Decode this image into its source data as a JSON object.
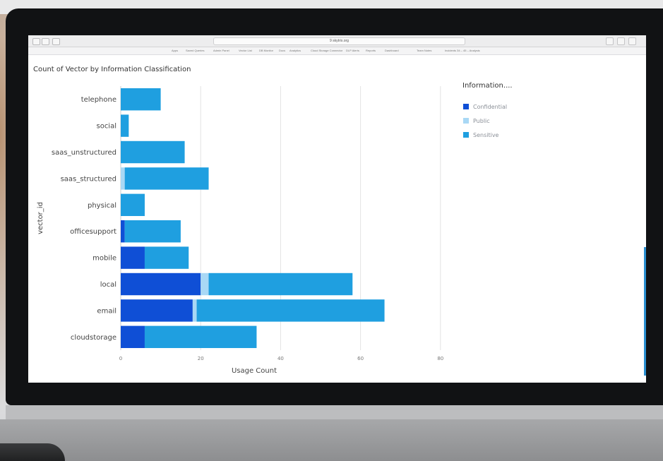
{
  "browser": {
    "address": "9 skytrix.org",
    "bookmarks": [
      "Apps",
      "Saved Queries",
      "Admin Panel",
      "Vector List",
      "DB Monitor",
      "Docs",
      "Analytics",
      "Cloud Storage Connector",
      "DLP Alerts",
      "Reports",
      "Dashboard",
      "Team Notes",
      "Incidents 34 – 45 – Analysis"
    ]
  },
  "chart_data": {
    "type": "bar",
    "orientation": "horizontal",
    "stacked": true,
    "title": "Count of Vector by Information Classification",
    "xlabel": "Usage Count",
    "ylabel": "vector_id",
    "categories": [
      "telephone",
      "social",
      "saas_unstructured",
      "saas_structured",
      "physical",
      "officesupport",
      "mobile",
      "local",
      "email",
      "cloudstorage"
    ],
    "series": [
      {
        "name": "Confidential",
        "color": "#0f4fd6",
        "values": [
          0,
          0,
          0,
          0,
          0,
          1,
          6,
          20,
          18,
          6
        ]
      },
      {
        "name": "Public",
        "color": "#a9d8f5",
        "values": [
          0,
          0,
          0,
          1,
          0,
          0,
          0,
          2,
          1,
          0
        ]
      },
      {
        "name": "Sensitive",
        "color": "#1f9fe0",
        "values": [
          10,
          2,
          16,
          21,
          6,
          14,
          11,
          36,
          47,
          28
        ]
      }
    ],
    "xlim": [
      0,
      80
    ],
    "xticks": [
      0,
      20,
      40,
      60,
      80
    ],
    "grid": true,
    "legend_title": "Information....",
    "legend_position": "right"
  }
}
